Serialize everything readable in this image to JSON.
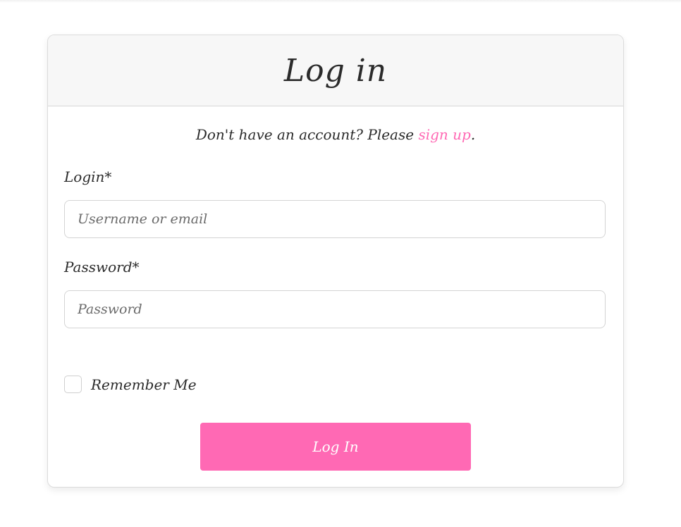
{
  "header": {
    "title": "Log in"
  },
  "signup": {
    "prefix": "Don't have an account? Please ",
    "link_label": "sign up",
    "suffix": "."
  },
  "form": {
    "login_label": "Login*",
    "login_placeholder": "Username or email",
    "login_value": "",
    "password_label": "Password*",
    "password_placeholder": "Password",
    "password_value": "",
    "remember_label": "Remember Me",
    "remember_checked": false,
    "submit_label": "Log In"
  },
  "colors": {
    "accent": "#ff69b4",
    "header_bg": "#f7f7f7",
    "text": "#2b2b2b",
    "border": "#d4d4d4"
  }
}
